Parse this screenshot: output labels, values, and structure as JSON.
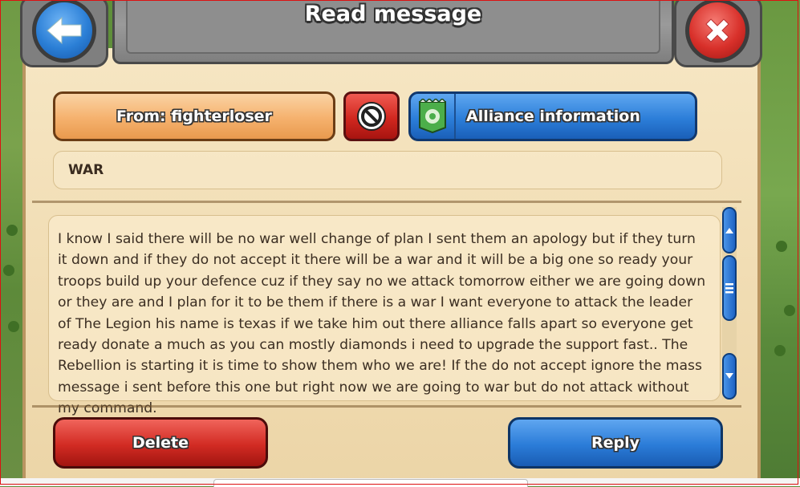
{
  "header": {
    "title": "Read message",
    "back_icon": "back-arrow-icon",
    "close_icon": "close-x-icon"
  },
  "sender": {
    "from_label": "From: fighterloser",
    "block_icon": "block-icon",
    "alliance_label": "Alliance information",
    "alliance_icon": "alliance-banner-icon"
  },
  "message": {
    "subject": "WAR",
    "body": "I know I said there will be no war well change of plan I sent them an apology but if they turn it down and if they do not accept it there will be a war and it will be a big one so ready your troops build up your defence cuz if they say no we attack tomorrow either we are going down or they are and I plan for it to be them if there is a war I want everyone to attack the leader of The Legion his name is texas if we take him out there alliance falls apart so everyone get ready donate a much as you can mostly diamonds i need to upgrade the support fast.. The Rebellion is starting it is time to show them who we are! If the do not accept ignore the mass message i sent before this one but right now we are going to war but do not attack without my command."
  },
  "actions": {
    "delete_label": "Delete",
    "reply_label": "Reply"
  },
  "colors": {
    "parchment": "#f1ddb4",
    "blue_button": "#2c7ed9",
    "red_button": "#d1271f",
    "orange_button": "#f5b16d"
  }
}
